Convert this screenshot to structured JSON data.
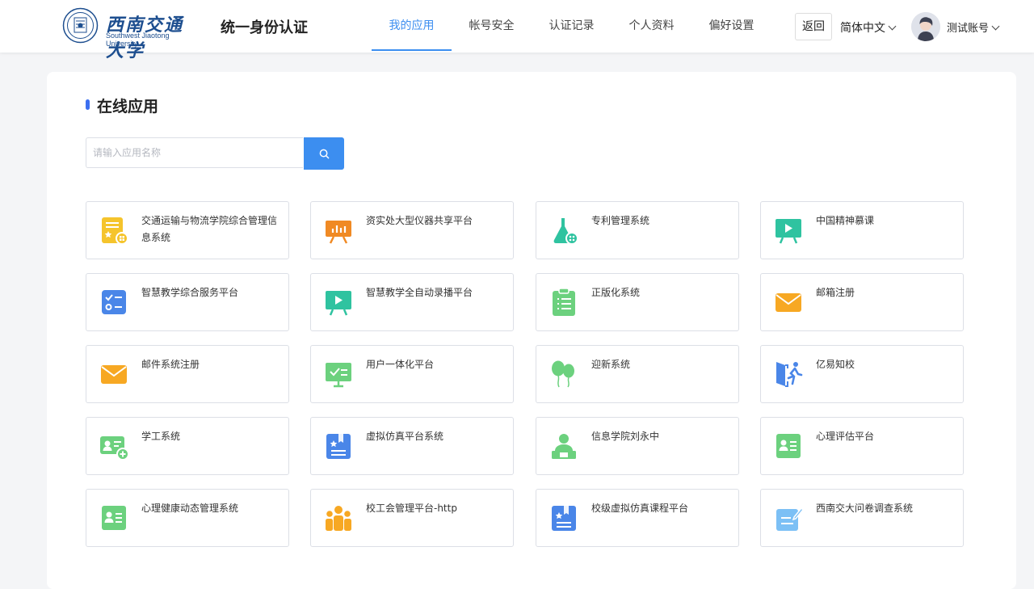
{
  "header": {
    "logo_cn": "西南交通大学",
    "logo_en": "Southwest Jiaotong University",
    "system_title": "统一身份认证",
    "nav": [
      {
        "label": "我的应用",
        "active": true
      },
      {
        "label": "帐号安全",
        "active": false
      },
      {
        "label": "认证记录",
        "active": false
      },
      {
        "label": "个人资料",
        "active": false
      },
      {
        "label": "偏好设置",
        "active": false
      }
    ],
    "back_label": "返回",
    "language": "简体中文",
    "username": "测试账号"
  },
  "main": {
    "section_title": "在线应用",
    "search_placeholder": "请输入应用名称",
    "apps": [
      {
        "name": "交通运输与物流学院综合管理信息系统",
        "icon": "document-star-icon",
        "color": "#f5c42c"
      },
      {
        "name": "资实处大型仪器共享平台",
        "icon": "presentation-chart-icon",
        "color": "#f08a24"
      },
      {
        "name": "专利管理系统",
        "icon": "flask-icon",
        "color": "#2fc3a0"
      },
      {
        "name": "中国精神慕课",
        "icon": "video-board-icon",
        "color": "#2fc3a0"
      },
      {
        "name": "智慧教学综合服务平台",
        "icon": "checklist-icon",
        "color": "#4a86e8"
      },
      {
        "name": "智慧教学全自动录播平台",
        "icon": "video-board-icon",
        "color": "#2fc3a0"
      },
      {
        "name": "正版化系统",
        "icon": "clipboard-list-icon",
        "color": "#6cd17e"
      },
      {
        "name": "邮箱注册",
        "icon": "envelope-icon",
        "color": "#f7a823"
      },
      {
        "name": "邮件系统注册",
        "icon": "envelope-icon",
        "color": "#f7a823"
      },
      {
        "name": "用户一体化平台",
        "icon": "monitor-check-icon",
        "color": "#6cd17e"
      },
      {
        "name": "迎新系统",
        "icon": "balloons-icon",
        "color": "#6cd17e"
      },
      {
        "name": "亿易知校",
        "icon": "door-exit-icon",
        "color": "#4a86e8"
      },
      {
        "name": "学工系统",
        "icon": "id-card-add-icon",
        "color": "#6cd17e"
      },
      {
        "name": "虚拟仿真平台系统",
        "icon": "book-star-icon",
        "color": "#4a86e8"
      },
      {
        "name": "信息学院刘永中",
        "icon": "person-desk-icon",
        "color": "#6cd17e"
      },
      {
        "name": "心理评估平台",
        "icon": "contact-card-icon",
        "color": "#6cd17e"
      },
      {
        "name": "心理健康动态管理系统",
        "icon": "contact-card-icon",
        "color": "#6cd17e"
      },
      {
        "name": "校工会管理平台-http",
        "icon": "group-people-icon",
        "color": "#f7a823"
      },
      {
        "name": "校级虚拟仿真课程平台",
        "icon": "book-star-icon",
        "color": "#4a86e8"
      },
      {
        "name": "西南交大问卷调查系统",
        "icon": "form-edit-icon",
        "color": "#7cc0f5"
      }
    ]
  }
}
